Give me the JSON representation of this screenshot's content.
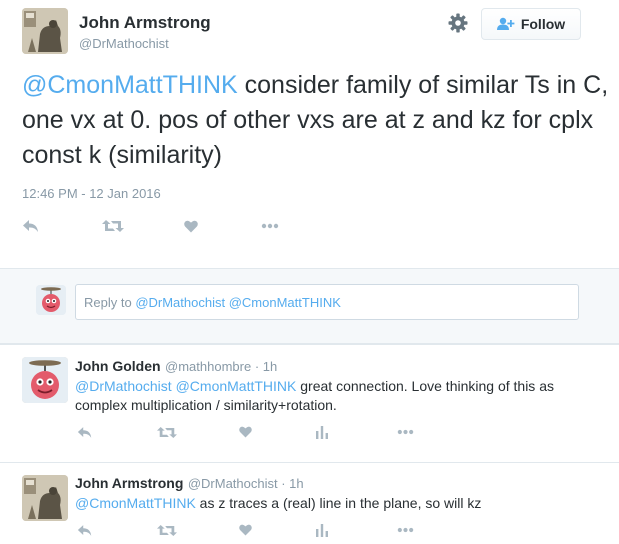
{
  "tweet": {
    "author_name": "John Armstrong",
    "author_handle": "@DrMathochist",
    "follow_label": "Follow",
    "mention": "@CmonMattTHINK",
    "text": " consider family of similar Ts in C, one vx at 0. pos of other vxs are at z and kz for cplx const k (similarity)",
    "timestamp": "12:46 PM - 12 Jan 2016"
  },
  "reply_box": {
    "prefix": "Reply to ",
    "mention1": "@DrMathochist",
    "mention2": "@CmonMattTHINK"
  },
  "replies": [
    {
      "name": "John Golden",
      "handle": "@mathhombre",
      "separator": " · ",
      "time": "1h",
      "mention1": "@DrMathochist",
      "mention2": "@CmonMattTHINK",
      "text": " great connection. Love thinking of this as complex multiplication / similarity+rotation."
    },
    {
      "name": "John Armstrong",
      "handle": "@DrMathochist",
      "separator": " · ",
      "time": "1h",
      "mention1": "@CmonMattTHINK",
      "text": " as z traces a (real) line in the plane, so will kz"
    }
  ],
  "icons": {
    "gear": "gear-icon",
    "follow": "add-user-icon",
    "reply": "reply-icon",
    "retweet": "retweet-icon",
    "like": "heart-icon",
    "analytics": "analytics-icon",
    "more": "more-icon"
  },
  "colors": {
    "link": "#55acee",
    "text": "#292f33",
    "muted": "#8899a6",
    "icon": "#aab8c2",
    "border": "#e1e8ed",
    "reply_bg": "#f5f8fa"
  }
}
